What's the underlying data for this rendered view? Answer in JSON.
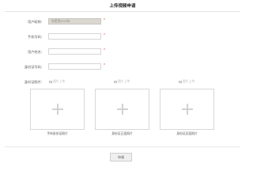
{
  "page": {
    "title": "上传视频申请"
  },
  "form": {
    "user_id": {
      "label": "用户昵称：",
      "value": "你是我2003年",
      "required_mark": "*"
    },
    "phone": {
      "label": "手机号码：",
      "value": "",
      "required_mark": "*"
    },
    "real_name": {
      "label": "用户姓名：",
      "value": "",
      "required_mark": "*"
    },
    "id_number": {
      "label": "身份证号码：",
      "value": "",
      "required_mark": "*"
    },
    "id_photos": {
      "label": "身份证照片：",
      "upload_text": "图片上传",
      "items": [
        {
          "caption": "手持身份证照片"
        },
        {
          "caption": "身份证正面照片"
        },
        {
          "caption": "身份证反面照片"
        }
      ]
    }
  },
  "actions": {
    "submit_label": "申请"
  }
}
